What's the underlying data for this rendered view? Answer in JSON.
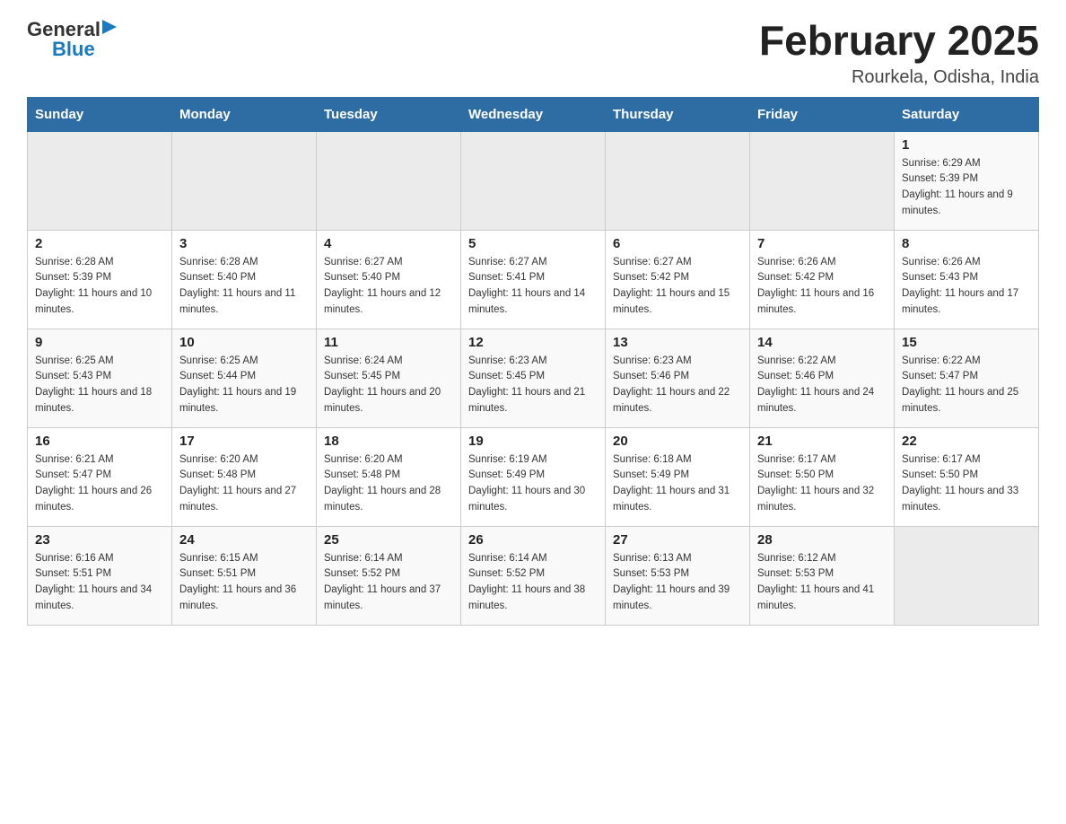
{
  "logo": {
    "general": "General",
    "blue": "Blue"
  },
  "title": "February 2025",
  "location": "Rourkela, Odisha, India",
  "days_of_week": [
    "Sunday",
    "Monday",
    "Tuesday",
    "Wednesday",
    "Thursday",
    "Friday",
    "Saturday"
  ],
  "weeks": [
    [
      {
        "day": "",
        "info": ""
      },
      {
        "day": "",
        "info": ""
      },
      {
        "day": "",
        "info": ""
      },
      {
        "day": "",
        "info": ""
      },
      {
        "day": "",
        "info": ""
      },
      {
        "day": "",
        "info": ""
      },
      {
        "day": "1",
        "info": "Sunrise: 6:29 AM\nSunset: 5:39 PM\nDaylight: 11 hours and 9 minutes."
      }
    ],
    [
      {
        "day": "2",
        "info": "Sunrise: 6:28 AM\nSunset: 5:39 PM\nDaylight: 11 hours and 10 minutes."
      },
      {
        "day": "3",
        "info": "Sunrise: 6:28 AM\nSunset: 5:40 PM\nDaylight: 11 hours and 11 minutes."
      },
      {
        "day": "4",
        "info": "Sunrise: 6:27 AM\nSunset: 5:40 PM\nDaylight: 11 hours and 12 minutes."
      },
      {
        "day": "5",
        "info": "Sunrise: 6:27 AM\nSunset: 5:41 PM\nDaylight: 11 hours and 14 minutes."
      },
      {
        "day": "6",
        "info": "Sunrise: 6:27 AM\nSunset: 5:42 PM\nDaylight: 11 hours and 15 minutes."
      },
      {
        "day": "7",
        "info": "Sunrise: 6:26 AM\nSunset: 5:42 PM\nDaylight: 11 hours and 16 minutes."
      },
      {
        "day": "8",
        "info": "Sunrise: 6:26 AM\nSunset: 5:43 PM\nDaylight: 11 hours and 17 minutes."
      }
    ],
    [
      {
        "day": "9",
        "info": "Sunrise: 6:25 AM\nSunset: 5:43 PM\nDaylight: 11 hours and 18 minutes."
      },
      {
        "day": "10",
        "info": "Sunrise: 6:25 AM\nSunset: 5:44 PM\nDaylight: 11 hours and 19 minutes."
      },
      {
        "day": "11",
        "info": "Sunrise: 6:24 AM\nSunset: 5:45 PM\nDaylight: 11 hours and 20 minutes."
      },
      {
        "day": "12",
        "info": "Sunrise: 6:23 AM\nSunset: 5:45 PM\nDaylight: 11 hours and 21 minutes."
      },
      {
        "day": "13",
        "info": "Sunrise: 6:23 AM\nSunset: 5:46 PM\nDaylight: 11 hours and 22 minutes."
      },
      {
        "day": "14",
        "info": "Sunrise: 6:22 AM\nSunset: 5:46 PM\nDaylight: 11 hours and 24 minutes."
      },
      {
        "day": "15",
        "info": "Sunrise: 6:22 AM\nSunset: 5:47 PM\nDaylight: 11 hours and 25 minutes."
      }
    ],
    [
      {
        "day": "16",
        "info": "Sunrise: 6:21 AM\nSunset: 5:47 PM\nDaylight: 11 hours and 26 minutes."
      },
      {
        "day": "17",
        "info": "Sunrise: 6:20 AM\nSunset: 5:48 PM\nDaylight: 11 hours and 27 minutes."
      },
      {
        "day": "18",
        "info": "Sunrise: 6:20 AM\nSunset: 5:48 PM\nDaylight: 11 hours and 28 minutes."
      },
      {
        "day": "19",
        "info": "Sunrise: 6:19 AM\nSunset: 5:49 PM\nDaylight: 11 hours and 30 minutes."
      },
      {
        "day": "20",
        "info": "Sunrise: 6:18 AM\nSunset: 5:49 PM\nDaylight: 11 hours and 31 minutes."
      },
      {
        "day": "21",
        "info": "Sunrise: 6:17 AM\nSunset: 5:50 PM\nDaylight: 11 hours and 32 minutes."
      },
      {
        "day": "22",
        "info": "Sunrise: 6:17 AM\nSunset: 5:50 PM\nDaylight: 11 hours and 33 minutes."
      }
    ],
    [
      {
        "day": "23",
        "info": "Sunrise: 6:16 AM\nSunset: 5:51 PM\nDaylight: 11 hours and 34 minutes."
      },
      {
        "day": "24",
        "info": "Sunrise: 6:15 AM\nSunset: 5:51 PM\nDaylight: 11 hours and 36 minutes."
      },
      {
        "day": "25",
        "info": "Sunrise: 6:14 AM\nSunset: 5:52 PM\nDaylight: 11 hours and 37 minutes."
      },
      {
        "day": "26",
        "info": "Sunrise: 6:14 AM\nSunset: 5:52 PM\nDaylight: 11 hours and 38 minutes."
      },
      {
        "day": "27",
        "info": "Sunrise: 6:13 AM\nSunset: 5:53 PM\nDaylight: 11 hours and 39 minutes."
      },
      {
        "day": "28",
        "info": "Sunrise: 6:12 AM\nSunset: 5:53 PM\nDaylight: 11 hours and 41 minutes."
      },
      {
        "day": "",
        "info": ""
      }
    ]
  ]
}
